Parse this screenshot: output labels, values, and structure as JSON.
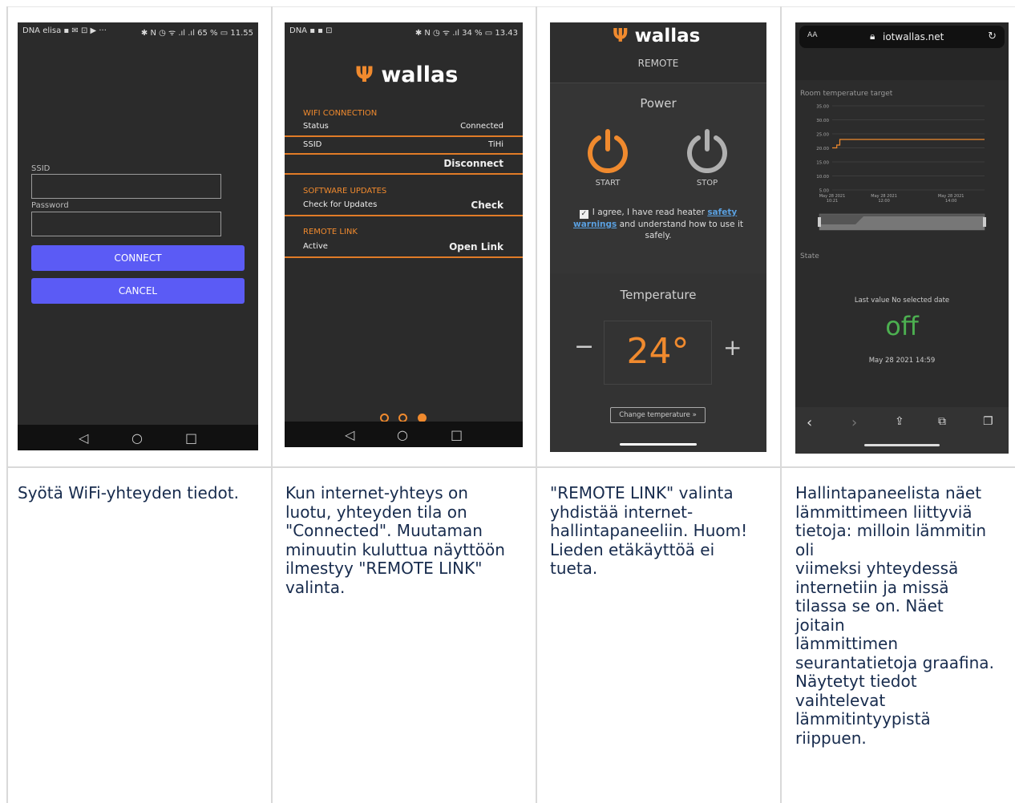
{
  "captions": [
    "Syötä WiFi-yhteyden tiedot.",
    "Kun internet-yhteys on\nluotu, yhteyden tila on\n\"Connected\". Muutaman\nminuutin kuluttua näyttöön\nilmestyy \"REMOTE LINK\"\nvalinta.",
    "\"REMOTE LINK\" valinta\nyhdistää internet-\nhallintapaneeliin. Huom!\nLieden etäkäyttöä ei\ntueta.",
    "Hallintapaneelista näet\nlämmittimeen liittyviä\ntietoja: milloin lämmitin\noli\nviimeksi yhteydessä\ninternetiin ja missä\ntilassa se on. Näet\njoitain\nlämmittimen\nseurantatietoja graafina.\nNäytetyt tiedot\nvaihtelevat\nlämmitintyypistä\nriippuen."
  ],
  "screen1": {
    "status_left": "DNA elisa ▪ ✉ ⊡ ▶ ···",
    "status_right": "✱ N ◷ ᯤ .ıl .ıl 65 % ▭ 11.55",
    "ssid_label": "SSID",
    "password_label": "Password",
    "connect": "CONNECT",
    "cancel": "CANCEL"
  },
  "screen2": {
    "status_left": "DNA ▪ ▪ ⊡",
    "status_right": "✱ N ◷ ᯤ .ıl 34 % ▭ 13.43",
    "brand": "wallas",
    "wifi_header": "WIFI CONNECTION",
    "status_label": "Status",
    "status_value": "Connected",
    "ssid_label": "SSID",
    "ssid_value": "TiHi",
    "disconnect": "Disconnect",
    "sw_header": "SOFTWARE UPDATES",
    "check_label": "Check for Updates",
    "check_button": "Check",
    "remote_header": "REMOTE LINK",
    "active_label": "Active",
    "open_link": "Open Link",
    "page_count": 3,
    "page_current": 3
  },
  "screen3": {
    "brand": "wallas",
    "subtitle": "REMOTE",
    "power_heading": "Power",
    "start": "START",
    "stop": "STOP",
    "agree_pre": "I agree, I have read heater",
    "agree_link": "safety warnings",
    "agree_post": "and understand how to use it safely.",
    "temp_heading": "Temperature",
    "minus": "−",
    "plus": "+",
    "temp_value": "24°",
    "change_temp": "Change temperature »",
    "accent": "#f08a2e"
  },
  "screen4": {
    "url": "iotwallas.net",
    "aa": "AA",
    "chart_title": "Room temperature target",
    "state_label": "State",
    "last_value": "Last value No selected date",
    "state_value": "off",
    "state_time": "May 28 2021 14:59",
    "state_color": "#4caf50"
  },
  "chart_data": {
    "type": "line",
    "title": "Room temperature target",
    "xlabel": "",
    "ylabel": "",
    "yticks": [
      "35.00",
      "30.00",
      "25.00",
      "20.00",
      "15.00",
      "10.00",
      "5.00"
    ],
    "ylim": [
      5,
      35
    ],
    "xticks": [
      "May 28 2021 10:21",
      "May 28 2021 12:00",
      "May 28 2021 14:00"
    ],
    "series": [
      {
        "values": [
          {
            "x": 0.0,
            "y": 20
          },
          {
            "x": 0.03,
            "y": 20
          },
          {
            "x": 0.03,
            "y": 21
          },
          {
            "x": 0.05,
            "y": 21
          },
          {
            "x": 0.05,
            "y": 23
          },
          {
            "x": 1.0,
            "y": 23
          }
        ]
      }
    ],
    "grid": true,
    "line_color": "#f08a2e"
  }
}
